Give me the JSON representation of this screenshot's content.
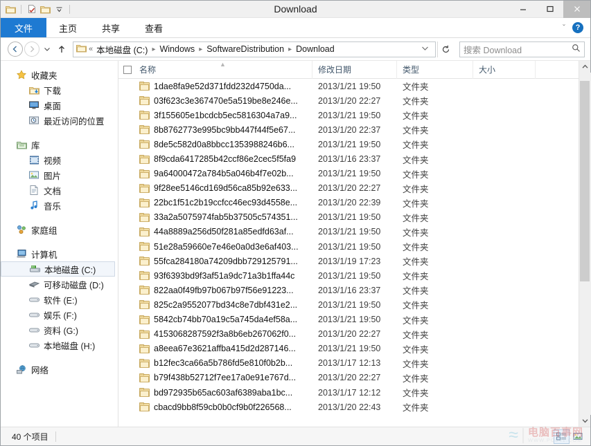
{
  "window": {
    "title": "Download",
    "minimize_label": "–",
    "maximize_label": "☐",
    "close_label": "✕"
  },
  "quick_access": {
    "items": [
      {
        "name": "folder-icon",
        "glyph": "📁"
      },
      {
        "name": "properties-icon",
        "glyph": "📄"
      },
      {
        "name": "new-folder-icon",
        "glyph": "📁"
      },
      {
        "name": "customize-dropdown-icon",
        "glyph": "▾"
      }
    ]
  },
  "ribbon": {
    "tabs": [
      {
        "label": "文件",
        "active": true
      },
      {
        "label": "主页",
        "active": false
      },
      {
        "label": "共享",
        "active": false
      },
      {
        "label": "查看",
        "active": false
      }
    ],
    "expand_icon": "ˇ",
    "help_label": "?"
  },
  "address": {
    "back_glyph": "←",
    "forward_glyph": "→",
    "recent_glyph": "▾",
    "up_glyph": "↑",
    "folder_glyph": "📁",
    "overflow": "«",
    "crumbs": [
      "本地磁盘 (C:)",
      "Windows",
      "SoftwareDistribution",
      "Download"
    ],
    "separator": "▸",
    "dropdown_glyph": "ˇ",
    "refresh_glyph": "↻"
  },
  "search": {
    "placeholder": "搜索 Download",
    "icon": "🔍"
  },
  "sidebar": {
    "groups": [
      {
        "header": {
          "label": "收藏夹",
          "icon": "⭐",
          "name": "favorites"
        },
        "items": [
          {
            "label": "下载",
            "icon": "⬇",
            "name": "downloads"
          },
          {
            "label": "桌面",
            "icon": "🖥",
            "name": "desktop"
          },
          {
            "label": "最近访问的位置",
            "icon": "🕓",
            "name": "recent-places"
          }
        ]
      },
      {
        "header": {
          "label": "库",
          "icon": "🗂",
          "name": "libraries"
        },
        "items": [
          {
            "label": "视频",
            "icon": "🎬",
            "name": "videos"
          },
          {
            "label": "图片",
            "icon": "🖼",
            "name": "pictures"
          },
          {
            "label": "文档",
            "icon": "📄",
            "name": "documents"
          },
          {
            "label": "音乐",
            "icon": "♪",
            "name": "music"
          }
        ]
      },
      {
        "header": {
          "label": "家庭组",
          "icon": "🏠",
          "name": "homegroup"
        },
        "items": []
      },
      {
        "header": {
          "label": "计算机",
          "icon": "💻",
          "name": "computer"
        },
        "items": [
          {
            "label": "本地磁盘 (C:)",
            "icon": "💽",
            "name": "drive-c",
            "selected": true
          },
          {
            "label": "可移动磁盘 (D:)",
            "icon": "━",
            "name": "drive-d"
          },
          {
            "label": "软件 (E:)",
            "icon": "💽",
            "name": "drive-e"
          },
          {
            "label": "娱乐 (F:)",
            "icon": "💽",
            "name": "drive-f"
          },
          {
            "label": "资料 (G:)",
            "icon": "💽",
            "name": "drive-g"
          },
          {
            "label": "本地磁盘 (H:)",
            "icon": "💽",
            "name": "drive-h"
          }
        ]
      },
      {
        "header": {
          "label": "网络",
          "icon": "🌐",
          "name": "network"
        },
        "items": []
      }
    ]
  },
  "filelist": {
    "columns": [
      {
        "key": "name",
        "label": "名称",
        "sorted": true,
        "sort_caret": "▲"
      },
      {
        "key": "date",
        "label": "修改日期"
      },
      {
        "key": "type",
        "label": "类型"
      },
      {
        "key": "size",
        "label": "大小"
      }
    ],
    "rows": [
      {
        "name": "1dae8fa9e52d371fdd232d4750da...",
        "date": "2013/1/21 19:50",
        "type": "文件夹",
        "size": ""
      },
      {
        "name": "03f623c3e367470e5a519be8e246e...",
        "date": "2013/1/20 22:27",
        "type": "文件夹",
        "size": ""
      },
      {
        "name": "3f155605e1bcdcb5ec5816304a7a9...",
        "date": "2013/1/21 19:50",
        "type": "文件夹",
        "size": ""
      },
      {
        "name": "8b8762773e995bc9bb447f44f5e67...",
        "date": "2013/1/20 22:37",
        "type": "文件夹",
        "size": ""
      },
      {
        "name": "8de5c582d0a8bbcc1353988246b6...",
        "date": "2013/1/21 19:50",
        "type": "文件夹",
        "size": ""
      },
      {
        "name": "8f9cda6417285b42ccf86e2cec5f5fa9",
        "date": "2013/1/16 23:37",
        "type": "文件夹",
        "size": ""
      },
      {
        "name": "9a64000472a784b5a046b4f7e02b...",
        "date": "2013/1/21 19:50",
        "type": "文件夹",
        "size": ""
      },
      {
        "name": "9f28ee5146cd169d56ca85b92e633...",
        "date": "2013/1/20 22:27",
        "type": "文件夹",
        "size": ""
      },
      {
        "name": "22bc1f51c2b19ccfcc46ec93d4558e...",
        "date": "2013/1/20 22:39",
        "type": "文件夹",
        "size": ""
      },
      {
        "name": "33a2a5075974fab5b37505c574351...",
        "date": "2013/1/21 19:50",
        "type": "文件夹",
        "size": ""
      },
      {
        "name": "44a8889a256d50f281a85edfd63af...",
        "date": "2013/1/21 19:50",
        "type": "文件夹",
        "size": ""
      },
      {
        "name": "51e28a59660e7e46e0a0d3e6af403...",
        "date": "2013/1/21 19:50",
        "type": "文件夹",
        "size": ""
      },
      {
        "name": "55fca284180a74209dbb729125791...",
        "date": "2013/1/19 17:23",
        "type": "文件夹",
        "size": ""
      },
      {
        "name": "93f6393bd9f3af51a9dc71a3b1ffa44c",
        "date": "2013/1/21 19:50",
        "type": "文件夹",
        "size": ""
      },
      {
        "name": "822aa0f49fb97b067b97f56e91223...",
        "date": "2013/1/16 23:37",
        "type": "文件夹",
        "size": ""
      },
      {
        "name": "825c2a9552077bd34c8e7dbf431e2...",
        "date": "2013/1/21 19:50",
        "type": "文件夹",
        "size": ""
      },
      {
        "name": "5842cb74bb70a19c5a745da4ef58a...",
        "date": "2013/1/21 19:50",
        "type": "文件夹",
        "size": ""
      },
      {
        "name": "4153068287592f3a8b6eb267062f0...",
        "date": "2013/1/20 22:27",
        "type": "文件夹",
        "size": ""
      },
      {
        "name": "a8eea67e3621affba415d2d287146...",
        "date": "2013/1/21 19:50",
        "type": "文件夹",
        "size": ""
      },
      {
        "name": "b12fec3ca66a5b786fd5e810f0b2b...",
        "date": "2013/1/17 12:13",
        "type": "文件夹",
        "size": ""
      },
      {
        "name": "b79f438b52712f7ee17a0e91e767d...",
        "date": "2013/1/20 22:27",
        "type": "文件夹",
        "size": ""
      },
      {
        "name": "bd972935b65ac603af6389aba1bc...",
        "date": "2013/1/17 12:12",
        "type": "文件夹",
        "size": ""
      },
      {
        "name": "cbacd9bb8f59cb0b0cf9b0f226568...",
        "date": "2013/1/20 22:43",
        "type": "文件夹",
        "size": ""
      }
    ]
  },
  "scrollbar": {
    "up_glyph": "∧",
    "down_glyph": "∨"
  },
  "statusbar": {
    "item_count": "40 个项目",
    "view_details_label": "☷",
    "view_icons_label": "▦"
  },
  "watermark": {
    "logo": "≈",
    "cn": "电脑百事网",
    "en": "WWW.PC841.COM"
  },
  "colors": {
    "accent": "#1e7ad2",
    "titlebar": "#f0f0f0",
    "close_btn": "#bdbdbd",
    "folder_body": "#fbf0cd",
    "folder_edge": "#cdaf69",
    "column_header_text": "#42576b",
    "scroll_thumb": "#cdcdcd",
    "watermark_red": "#d04040"
  }
}
